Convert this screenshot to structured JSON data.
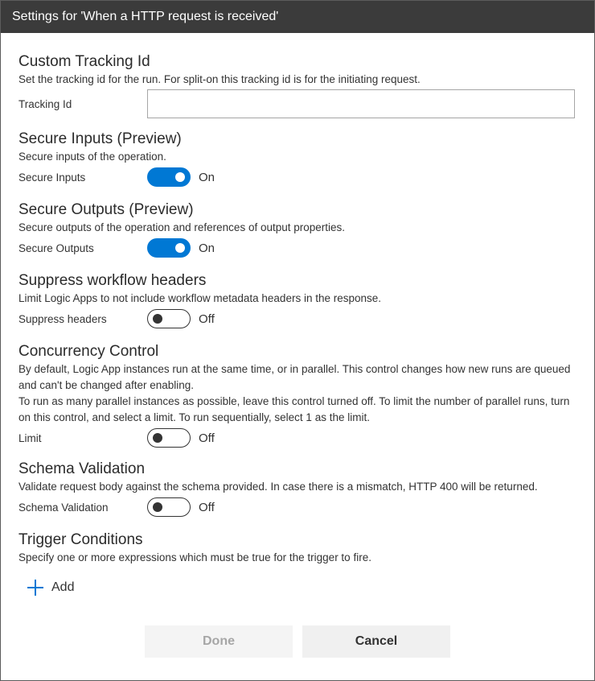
{
  "dialog": {
    "title": "Settings for 'When a HTTP request is received'"
  },
  "tracking": {
    "title": "Custom Tracking Id",
    "description": "Set the tracking id for the run. For split-on this tracking id is for the initiating request.",
    "label": "Tracking Id",
    "value": "",
    "placeholder": ""
  },
  "secure_inputs": {
    "title": "Secure Inputs (Preview)",
    "description": "Secure inputs of the operation.",
    "label": "Secure Inputs",
    "state": "On"
  },
  "secure_outputs": {
    "title": "Secure Outputs (Preview)",
    "description": "Secure outputs of the operation and references of output properties.",
    "label": "Secure Outputs",
    "state": "On"
  },
  "suppress_headers": {
    "title": "Suppress workflow headers",
    "description": "Limit Logic Apps to not include workflow metadata headers in the response.",
    "label": "Suppress headers",
    "state": "Off"
  },
  "concurrency": {
    "title": "Concurrency Control",
    "description_1": "By default, Logic App instances run at the same time, or in parallel. This control changes how new runs are queued and can't be changed after enabling.",
    "description_2": "To run as many parallel instances as possible, leave this control turned off. To limit the number of parallel runs, turn on this control, and select a limit. To run sequentially, select 1 as the limit.",
    "label": "Limit",
    "state": "Off"
  },
  "schema_validation": {
    "title": "Schema Validation",
    "description": "Validate request body against the schema provided. In case there is a mismatch, HTTP 400 will be returned.",
    "label": "Schema Validation",
    "state": "Off"
  },
  "trigger_conditions": {
    "title": "Trigger Conditions",
    "description": "Specify one or more expressions which must be true for the trigger to fire.",
    "add_label": "Add"
  },
  "footer": {
    "done_label": "Done",
    "cancel_label": "Cancel"
  },
  "colors": {
    "accent": "#0078d4",
    "titlebar": "#3b3b3b"
  },
  "icons": {
    "add": "plus-icon"
  }
}
